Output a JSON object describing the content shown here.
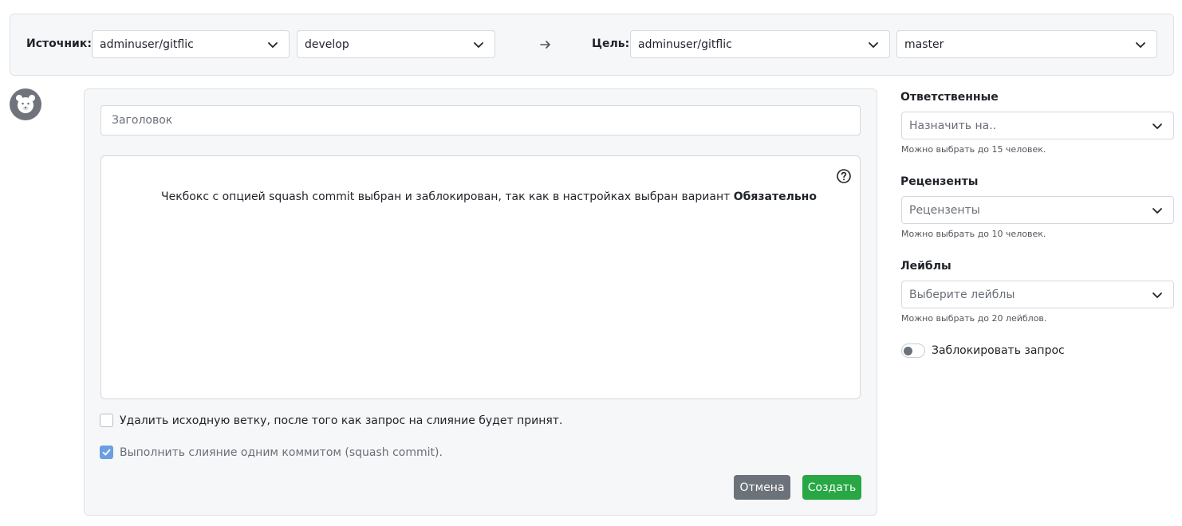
{
  "branch_bar": {
    "source_label": "Источник:",
    "source_repo": "adminuser/gitflic",
    "source_branch": "develop",
    "target_label": "Цель:",
    "target_repo": "adminuser/gitflic",
    "target_branch": "master",
    "arrow_icon": "arrow-right-icon"
  },
  "form": {
    "title_placeholder": "Заголовок",
    "description_text": "Чекбокс с опцией squash commit выбран и заблокирован, так как в настройках выбран вариант ",
    "description_bold": "Обязательно",
    "help_icon": "question-circle-icon",
    "delete_branch_label": "Удалить исходную ветку, после того как запрос на слияние будет принят.",
    "delete_branch_checked": false,
    "squash_label": "Выполнить слияние одним коммитом (squash commit).",
    "squash_checked": true,
    "cancel_label": "Отмена",
    "create_label": "Создать"
  },
  "sidebar": {
    "assignees_label": "Ответственные",
    "assignees_placeholder": "Назначить на..",
    "assignees_hint": "Можно выбрать до 15 человек.",
    "reviewers_label": "Рецензенты",
    "reviewers_placeholder": "Рецензенты",
    "reviewers_hint": "Можно выбрать до 10 человек.",
    "labels_label": "Лейблы",
    "labels_placeholder": "Выберите лейблы",
    "labels_hint": "Можно выбрать до 20 лейблов.",
    "lock_label": "Заблокировать запрос",
    "lock_enabled": false
  },
  "colors": {
    "create_button": "#28a745",
    "cancel_button": "#6c727a",
    "checkbox_checked": "#6b9fe0"
  }
}
